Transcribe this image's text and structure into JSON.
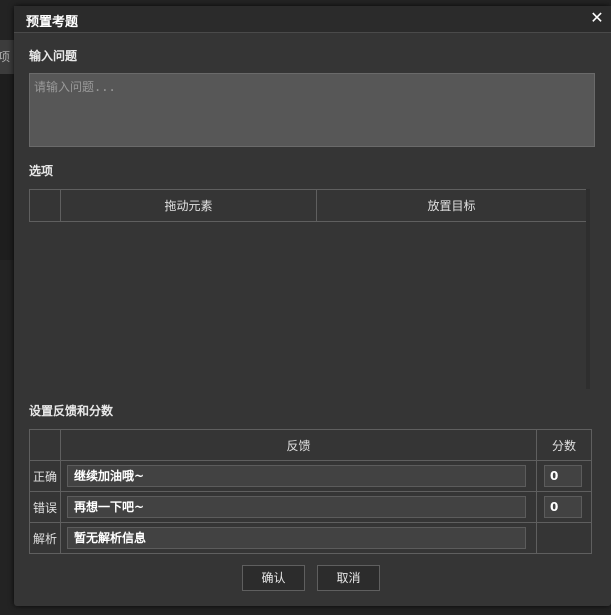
{
  "background": {
    "sliver_text": "项"
  },
  "dialog": {
    "title": "预置考题",
    "close_glyph": "✕",
    "question": {
      "label": "输入问题",
      "placeholder": "请输入问题..."
    },
    "options": {
      "label": "选项",
      "columns": [
        "",
        "拖动元素",
        "放置目标"
      ]
    },
    "feedback": {
      "label": "设置反馈和分数",
      "columns": [
        "",
        "反馈",
        "分数"
      ],
      "rows": [
        {
          "label": "正确",
          "feedback": "继续加油哦~",
          "score": "0"
        },
        {
          "label": "错误",
          "feedback": "再想一下吧~",
          "score": "0"
        },
        {
          "label": "解析",
          "feedback": "暂无解析信息",
          "score": null
        }
      ]
    },
    "buttons": {
      "confirm": "确认",
      "cancel": "取消"
    }
  },
  "colors": {
    "dialog_bg": "#353535",
    "titlebar_bg": "#2b2b2b",
    "input_bg": "#575757",
    "border": "#5f5f5f"
  }
}
